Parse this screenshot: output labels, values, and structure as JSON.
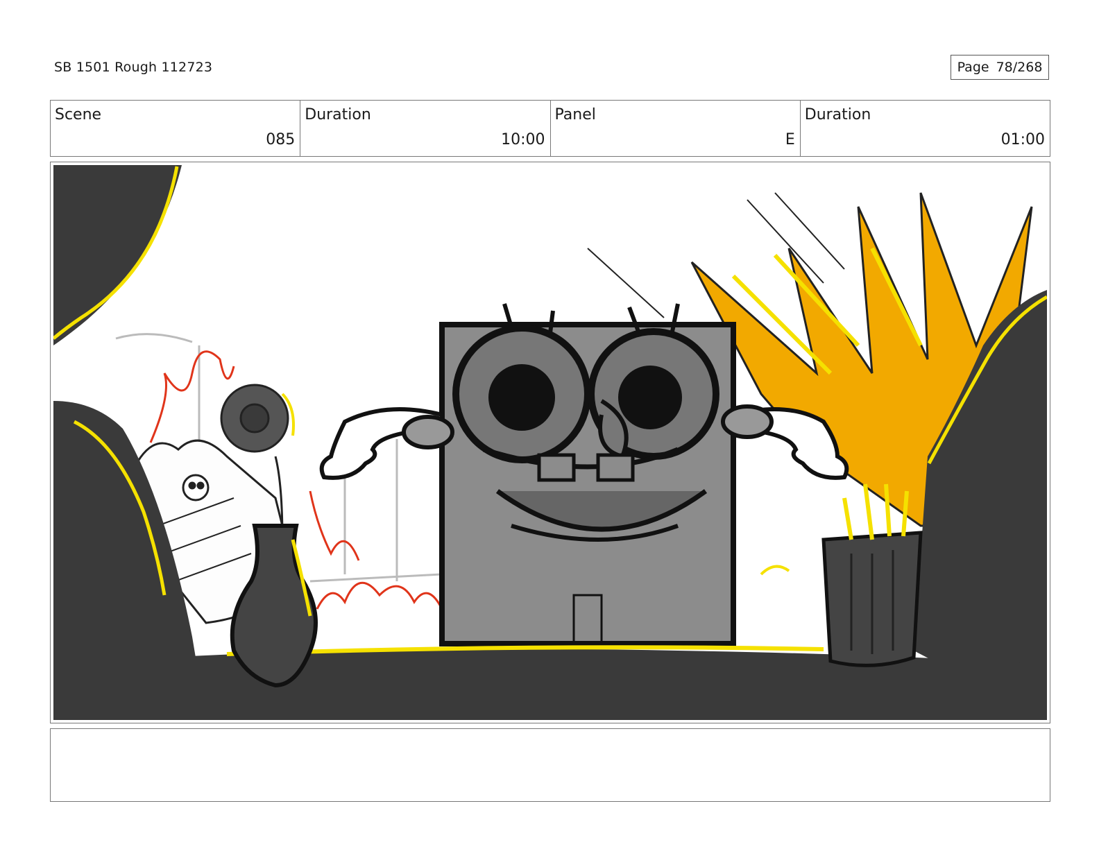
{
  "header": {
    "doc_title": "SB 1501 Rough 112723",
    "page_label": "Page",
    "page_number": "78/268"
  },
  "info": {
    "scene_label": "Scene",
    "scene_value": "085",
    "scene_duration_label": "Duration",
    "scene_duration_value": "10:00",
    "panel_label": "Panel",
    "panel_value": "E",
    "panel_duration_label": "Duration",
    "panel_duration_value": "01:00"
  },
  "notes": {
    "text": ""
  },
  "colors": {
    "accent_yellow": "#f5e100",
    "explosion_orange": "#f2a900",
    "fire_red": "#e0341a",
    "dark_gray": "#3a3a3a"
  }
}
